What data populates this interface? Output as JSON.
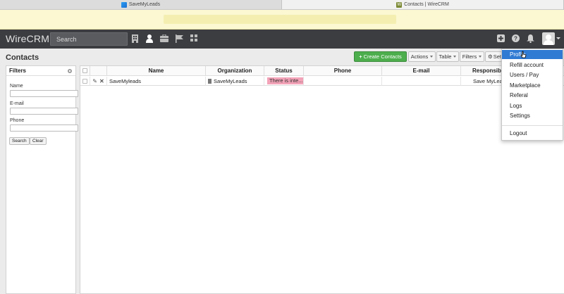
{
  "browser": {
    "tabs": [
      {
        "label": "SaveMyLeads"
      },
      {
        "label": "Contacts | WireCRM"
      }
    ]
  },
  "app": {
    "brand": "WireCRM",
    "search_placeholder": "Search",
    "nav_icons": [
      "organizations-icon",
      "contacts-icon",
      "deals-icon",
      "flag-icon",
      "apps-icon"
    ]
  },
  "page": {
    "title": "Contacts",
    "toolbar": {
      "create": "Create Contacts",
      "actions": "Actions",
      "table": "Table",
      "filters": "Filters",
      "settings": "Set"
    }
  },
  "filters": {
    "title": "Filters",
    "fields": [
      {
        "label": "Name",
        "value": ""
      },
      {
        "label": "E-mail",
        "value": ""
      },
      {
        "label": "Phone",
        "value": ""
      }
    ],
    "search_button": "Search",
    "clear_button": "Clear"
  },
  "table": {
    "columns": [
      "Name",
      "Organization",
      "Status",
      "Phone",
      "E-mail",
      "Responsib"
    ],
    "rows": [
      {
        "name": "SaveMyleads",
        "organization": "SaveMyLeads",
        "status": "There is inte...",
        "phone": "",
        "email": "",
        "responsible": "Save MyLea"
      }
    ]
  },
  "user_menu": {
    "items": [
      "Profile",
      "Refill account",
      "Users / Pay",
      "Marketplace",
      "Referal",
      "Logs",
      "Settings"
    ],
    "logout": "Logout",
    "active_index": 0
  },
  "colors": {
    "topbar": "#3c3d41",
    "create_button": "#4cae4c",
    "status_pill": "#f3a3b8",
    "menu_active": "#2f7ad3",
    "notice": "#fbf8d2"
  }
}
